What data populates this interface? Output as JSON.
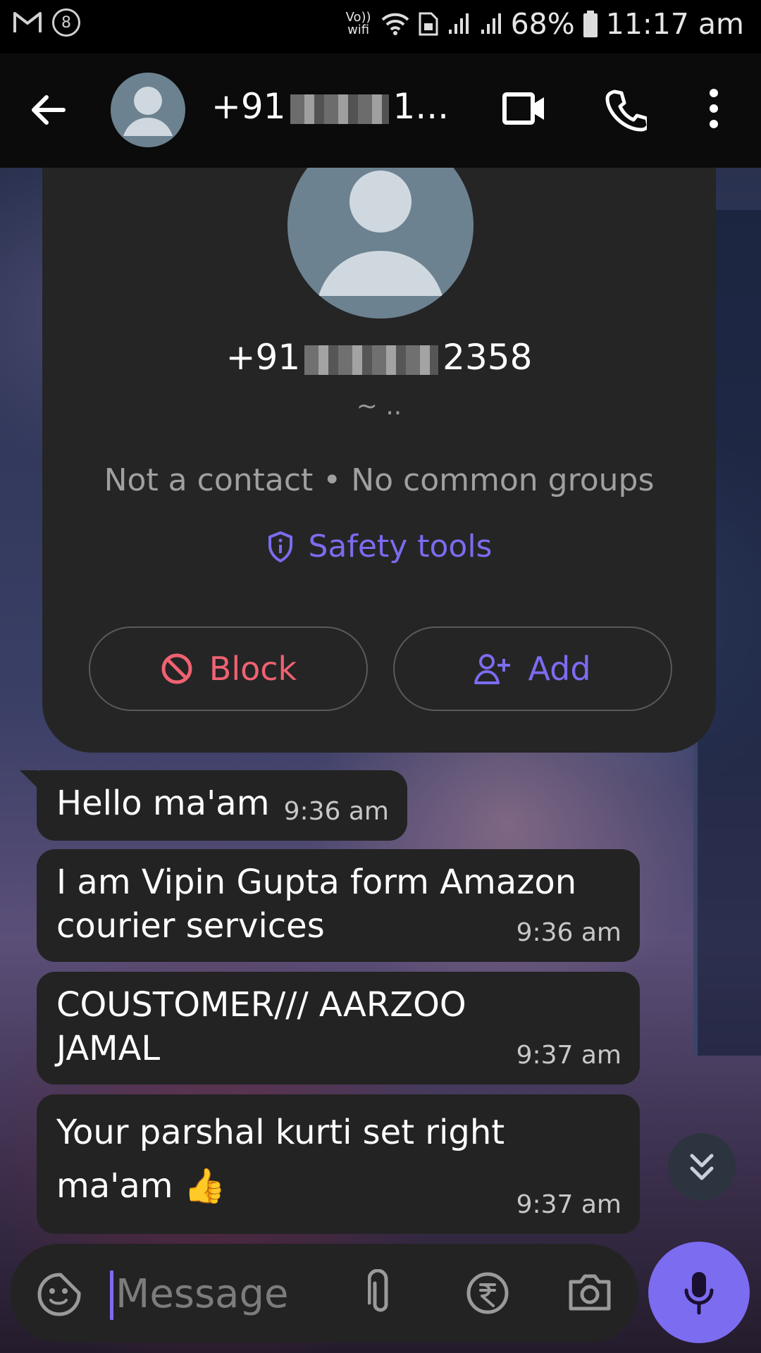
{
  "status_bar": {
    "left_icons": [
      "gmail-icon",
      "notification-count-icon"
    ],
    "notification_count": "8",
    "network_label": "Vo)) wifi",
    "battery_percent": "68%",
    "time": "11:17 am"
  },
  "app_bar": {
    "title_prefix": "+91",
    "title_suffix": "1...",
    "actions": [
      "video-call-icon",
      "voice-call-icon",
      "more-options-icon"
    ]
  },
  "contact_card": {
    "phone_prefix": "+91",
    "phone_suffix": "2358",
    "about": "~ ..",
    "info": "Not a contact • No common groups",
    "safety_tools_label": "Safety tools",
    "block_label": "Block",
    "add_label": "Add",
    "colors": {
      "accent": "#7b6cf0",
      "danger": "#f06272"
    }
  },
  "messages": [
    {
      "text": "Hello ma'am",
      "time": "9:36 am"
    },
    {
      "text": "I am Vipin Gupta form Amazon courier services",
      "time": "9:36 am"
    },
    {
      "text": "COUSTOMER/// AARZOO JAMAL",
      "time": "9:37 am"
    },
    {
      "text": "Your parshal kurti set right ma'am 👍",
      "time": "9:37 am"
    }
  ],
  "composer": {
    "placeholder": "Message",
    "icons": [
      "sticker-icon",
      "attachment-icon",
      "payment-rupee-icon",
      "camera-icon",
      "mic-icon"
    ]
  }
}
